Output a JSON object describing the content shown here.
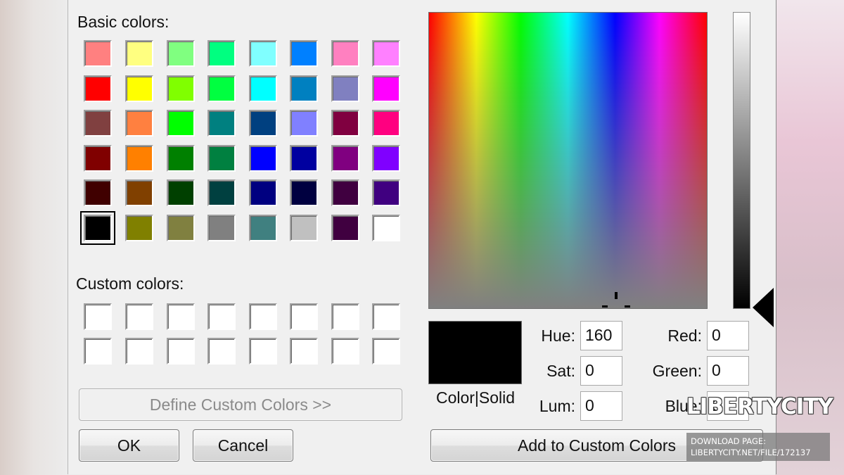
{
  "dialog": {
    "basic_colors_label": "Basic colors:",
    "custom_colors_label": "Custom colors:",
    "define_custom_label": "Define Custom Colors >>",
    "ok_label": "OK",
    "cancel_label": "Cancel",
    "add_custom_label": "Add to Custom Colors",
    "color_solid_label": "Color|Solid",
    "selected_color": "#000000",
    "luminosity_level": 0
  },
  "basic_colors": [
    "#ff8080",
    "#ffff80",
    "#80ff80",
    "#00ff80",
    "#80ffff",
    "#0080ff",
    "#ff80c0",
    "#ff80ff",
    "#ff0000",
    "#ffff00",
    "#80ff00",
    "#00ff40",
    "#00ffff",
    "#0080c0",
    "#8080c0",
    "#ff00ff",
    "#804040",
    "#ff8040",
    "#00ff00",
    "#008080",
    "#004080",
    "#8080ff",
    "#800040",
    "#ff0080",
    "#800000",
    "#ff8000",
    "#008000",
    "#008040",
    "#0000ff",
    "#0000a0",
    "#800080",
    "#8000ff",
    "#400000",
    "#804000",
    "#004000",
    "#004040",
    "#000080",
    "#000040",
    "#400040",
    "#400080",
    "#000000",
    "#808000",
    "#808040",
    "#808080",
    "#408080",
    "#c0c0c0",
    "#400040",
    "#ffffff"
  ],
  "selected_basic_index": 40,
  "custom_colors": [
    "#ffffff",
    "#ffffff",
    "#ffffff",
    "#ffffff",
    "#ffffff",
    "#ffffff",
    "#ffffff",
    "#ffffff",
    "#ffffff",
    "#ffffff",
    "#ffffff",
    "#ffffff",
    "#ffffff",
    "#ffffff",
    "#ffffff",
    "#ffffff"
  ],
  "fields": {
    "hue_label": "Hue:",
    "hue_value": "160",
    "sat_label": "Sat:",
    "sat_value": "0",
    "lum_label": "Lum:",
    "lum_value": "0",
    "red_label": "Red:",
    "red_value": "0",
    "green_label": "Green:",
    "green_value": "0",
    "blue_label": "Blue:",
    "blue_value": "0"
  },
  "watermark": {
    "logo_text": "LIBERTYCITY",
    "download_line1": "DOWNLOAD PAGE:",
    "download_line2": "LIBERTYCITY.NET/FILE/172137"
  }
}
